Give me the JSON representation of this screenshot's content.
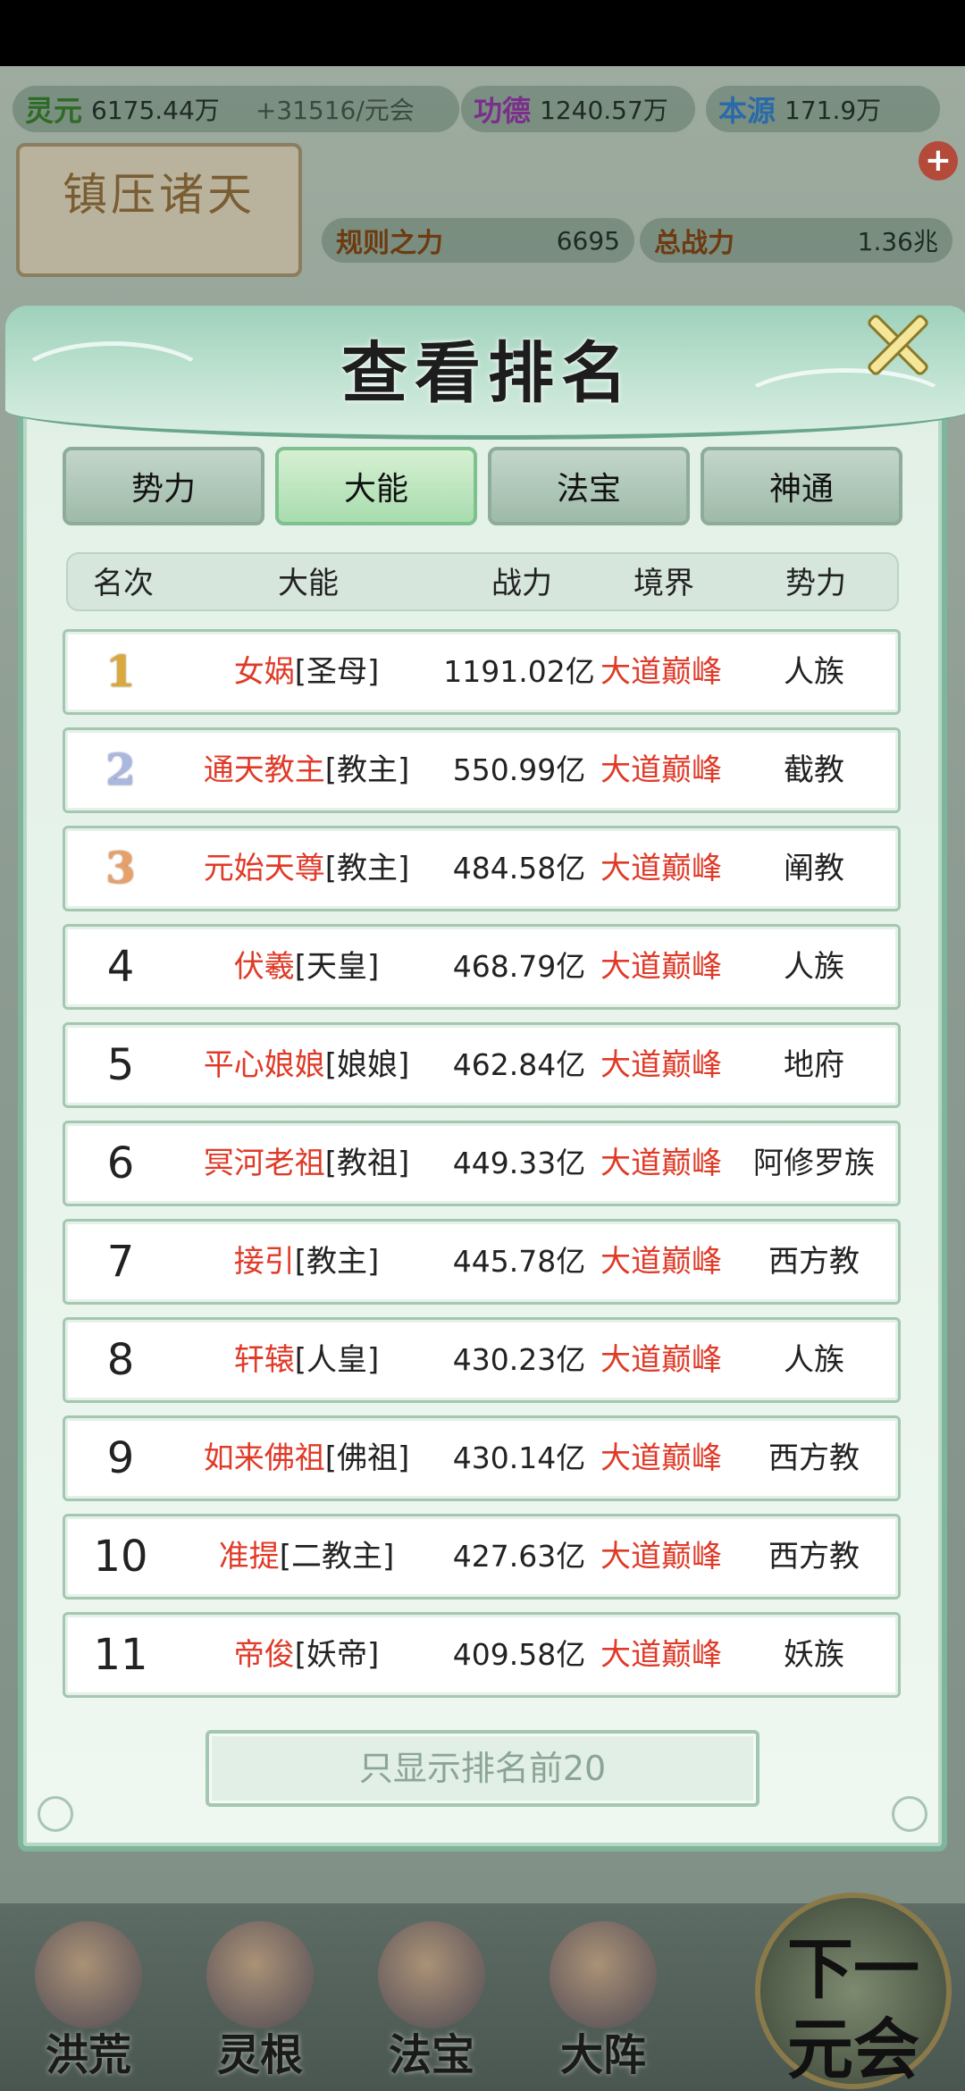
{
  "top_bar": {
    "lingyuan_label": "灵元",
    "lingyuan_value": "6175.44万",
    "lingyuan_rate": "+31516/元会",
    "gongde_label": "功德",
    "gongde_value": "1240.57万",
    "benyuan_label": "本源",
    "benyuan_value": "171.9万"
  },
  "badge": {
    "title": "镇压诸天"
  },
  "stats": {
    "guize_label": "规则之力",
    "guize_value": "6695",
    "zhanli_label": "总战力",
    "zhanli_value": "1.36兆"
  },
  "modal": {
    "title": "查看排名",
    "tabs": [
      {
        "label": "势力",
        "active": false
      },
      {
        "label": "大能",
        "active": true
      },
      {
        "label": "法宝",
        "active": false
      },
      {
        "label": "神通",
        "active": false
      }
    ],
    "columns": [
      "名次",
      "大能",
      "战力",
      "境界",
      "势力"
    ],
    "rows": [
      {
        "rank": "1",
        "name": "女娲",
        "title": "[圣母]",
        "power": "1191.02亿",
        "realm": "大道巅峰",
        "faction": "人族"
      },
      {
        "rank": "2",
        "name": "通天教主",
        "title": "[教主]",
        "power": "550.99亿",
        "realm": "大道巅峰",
        "faction": "截教"
      },
      {
        "rank": "3",
        "name": "元始天尊",
        "title": "[教主]",
        "power": "484.58亿",
        "realm": "大道巅峰",
        "faction": "阐教"
      },
      {
        "rank": "4",
        "name": "伏羲",
        "title": "[天皇]",
        "power": "468.79亿",
        "realm": "大道巅峰",
        "faction": "人族"
      },
      {
        "rank": "5",
        "name": "平心娘娘",
        "title": "[娘娘]",
        "power": "462.84亿",
        "realm": "大道巅峰",
        "faction": "地府"
      },
      {
        "rank": "6",
        "name": "冥河老祖",
        "title": "[教祖]",
        "power": "449.33亿",
        "realm": "大道巅峰",
        "faction": "阿修罗族"
      },
      {
        "rank": "7",
        "name": "接引",
        "title": "[教主]",
        "power": "445.78亿",
        "realm": "大道巅峰",
        "faction": "西方教"
      },
      {
        "rank": "8",
        "name": "轩辕",
        "title": "[人皇]",
        "power": "430.23亿",
        "realm": "大道巅峰",
        "faction": "人族"
      },
      {
        "rank": "9",
        "name": "如来佛祖",
        "title": "[佛祖]",
        "power": "430.14亿",
        "realm": "大道巅峰",
        "faction": "西方教"
      },
      {
        "rank": "10",
        "name": "准提",
        "title": "[二教主]",
        "power": "427.63亿",
        "realm": "大道巅峰",
        "faction": "西方教"
      },
      {
        "rank": "11",
        "name": "帝俊",
        "title": "[妖帝]",
        "power": "409.58亿",
        "realm": "大道巅峰",
        "faction": "妖族"
      }
    ],
    "show_top_label": "只显示排名前20"
  },
  "bottom_nav": {
    "items": [
      "洪荒",
      "灵根",
      "法宝",
      "大阵"
    ],
    "next_line1": "下一",
    "next_line2": "元会"
  },
  "colors": {
    "accent_red": "#e03a28",
    "panel_green": "#7fb59b",
    "tab_active": "#a8dcae"
  }
}
